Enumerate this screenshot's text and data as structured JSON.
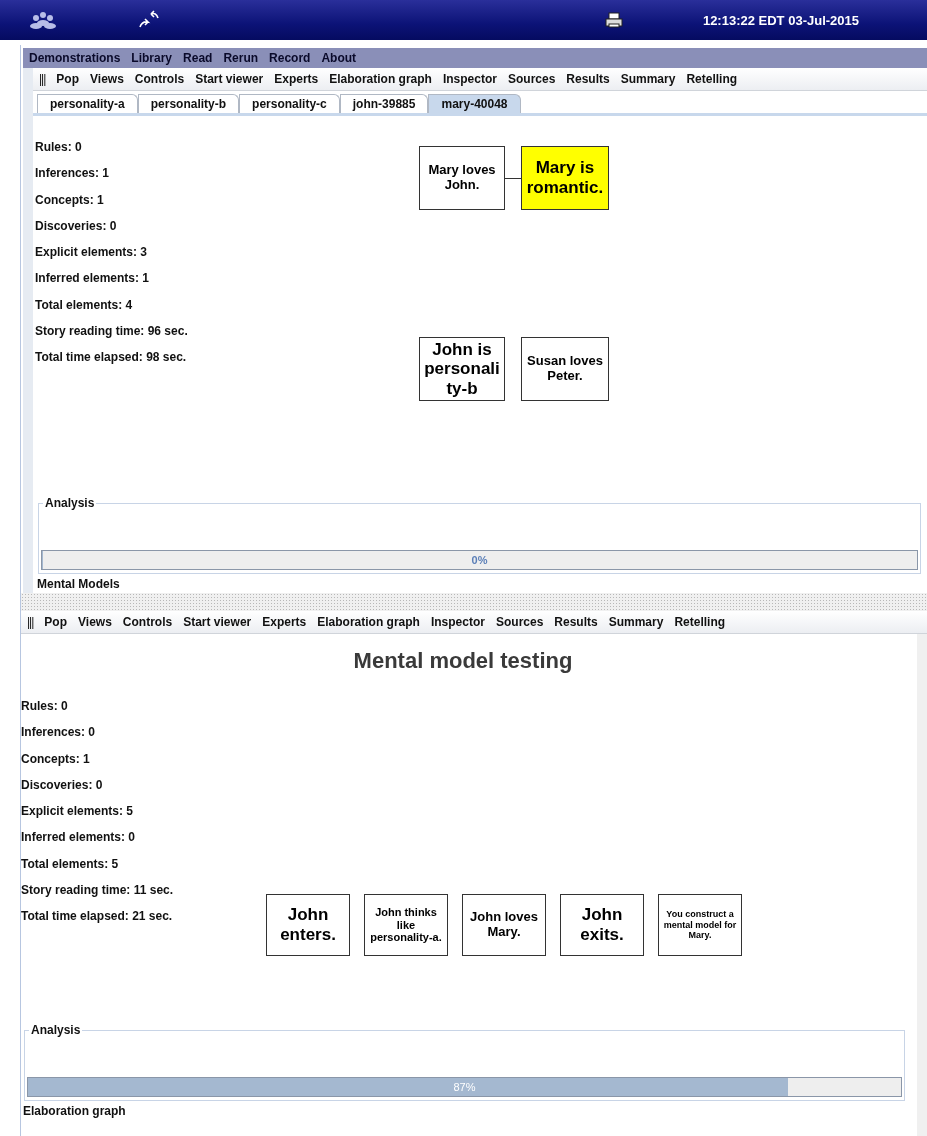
{
  "top_bar": {
    "clock": "12:13:22 EDT 03-Jul-2015"
  },
  "menu_bar": [
    "Demonstrations",
    "Library",
    "Read",
    "Rerun",
    "Record",
    "About"
  ],
  "upper_panel": {
    "toolbar": {
      "handle": "|||",
      "items": [
        "Pop",
        "Views",
        "Controls",
        "Start viewer",
        "Experts",
        "Elaboration graph",
        "Inspector",
        "Sources",
        "Results",
        "Summary",
        "Retelling"
      ]
    },
    "tabs": [
      {
        "label": "personality-a",
        "selected": false
      },
      {
        "label": "personality-b",
        "selected": false
      },
      {
        "label": "personality-c",
        "selected": false
      },
      {
        "label": "john-39885",
        "selected": false
      },
      {
        "label": "mary-40048",
        "selected": true
      }
    ],
    "stats": [
      "Rules: 0",
      "Inferences: 1",
      "Concepts: 1",
      "Discoveries: 0",
      "Explicit elements: 3",
      "Inferred elements: 1",
      "Total elements: 4",
      "Story reading time: 96 sec.",
      "Total time elapsed: 98 sec."
    ],
    "nodes": [
      {
        "text": "Mary loves John.",
        "kind": "medium",
        "highlighted": false
      },
      {
        "text": "Mary is romantic.",
        "kind": "large",
        "highlighted": true
      },
      {
        "text": "John is personality-b",
        "kind": "large",
        "highlighted": false
      },
      {
        "text": "Susan loves Peter.",
        "kind": "medium",
        "highlighted": false
      }
    ],
    "first_pair_linked": true,
    "analysis": {
      "title": "Analysis",
      "level": 0,
      "reading": "0%"
    },
    "footer": "Mental Models"
  },
  "lower_panel": {
    "toolbar": {
      "handle": "|||",
      "items": [
        "Pop",
        "Views",
        "Controls",
        "Start viewer",
        "Experts",
        "Elaboration graph",
        "Inspector",
        "Sources",
        "Results",
        "Summary",
        "Retelling"
      ]
    },
    "title": "Mental model testing",
    "stats": [
      "Rules: 0",
      "Inferences: 0",
      "Concepts: 1",
      "Discoveries: 0",
      "Explicit elements: 5",
      "Inferred elements: 0",
      "Total elements: 5",
      "Story reading time: 11 sec.",
      "Total time elapsed: 21 sec."
    ],
    "nodes": [
      {
        "text": "John enters.",
        "kind": "large",
        "highlighted": false
      },
      {
        "text": "John thinks like personality-a.",
        "kind": "small",
        "highlighted": false
      },
      {
        "text": "John loves Mary.",
        "kind": "medium",
        "highlighted": false
      },
      {
        "text": "John exits.",
        "kind": "large",
        "highlighted": false
      },
      {
        "text": "You construct a mental model for Mary.",
        "kind": "tiny",
        "highlighted": false
      }
    ],
    "analysis": {
      "title": "Analysis",
      "level": 0.87,
      "reading": "87%"
    },
    "footer": "Elaboration graph"
  }
}
